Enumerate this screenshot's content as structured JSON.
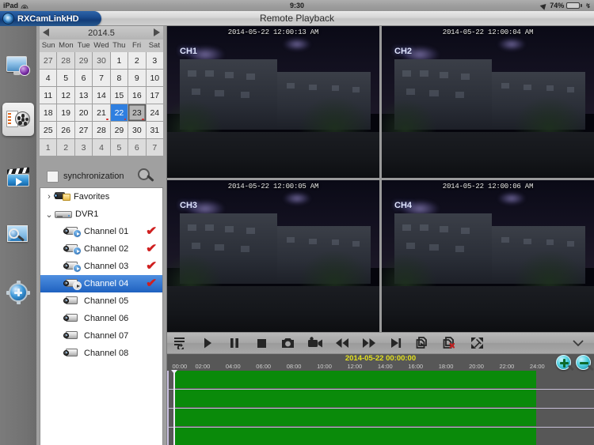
{
  "statusbar": {
    "device": "iPad",
    "time": "9:30",
    "battery": "74%",
    "wifi_icon": "wifi-icon",
    "location_icon": "location-arrow-icon",
    "battery_icon": "battery-icon"
  },
  "titlebar": {
    "app_name": "RXCamLinkHD",
    "title": "Remote Playback"
  },
  "rail": {
    "items": [
      {
        "name": "live-view",
        "icon": "monitor-camera-icon",
        "selected": false
      },
      {
        "name": "remote-playback",
        "icon": "film-reel-icon",
        "selected": true
      },
      {
        "name": "local-playback",
        "icon": "clapperboard-play-icon",
        "selected": false
      },
      {
        "name": "picture-viewer",
        "icon": "photo-magnifier-icon",
        "selected": false
      },
      {
        "name": "settings",
        "icon": "gear-icon",
        "selected": false
      }
    ]
  },
  "calendar": {
    "year_month": "2014.5",
    "prev_icon": "prev-arrow-icon",
    "next_icon": "next-arrow-icon",
    "dows": [
      "Sun",
      "Mon",
      "Tue",
      "Wed",
      "Thu",
      "Fri",
      "Sat"
    ],
    "weeks": [
      [
        {
          "d": "27",
          "dim": true
        },
        {
          "d": "28",
          "dim": true
        },
        {
          "d": "29",
          "dim": true
        },
        {
          "d": "30",
          "dim": true
        },
        {
          "d": "1"
        },
        {
          "d": "2"
        },
        {
          "d": "3"
        }
      ],
      [
        {
          "d": "4"
        },
        {
          "d": "5"
        },
        {
          "d": "6"
        },
        {
          "d": "7"
        },
        {
          "d": "8"
        },
        {
          "d": "9"
        },
        {
          "d": "10"
        }
      ],
      [
        {
          "d": "11"
        },
        {
          "d": "12"
        },
        {
          "d": "13"
        },
        {
          "d": "14"
        },
        {
          "d": "15"
        },
        {
          "d": "16"
        },
        {
          "d": "17"
        }
      ],
      [
        {
          "d": "18"
        },
        {
          "d": "19"
        },
        {
          "d": "20"
        },
        {
          "d": "21",
          "dot": true
        },
        {
          "d": "22",
          "sel": true,
          "dot": true
        },
        {
          "d": "23",
          "today": true,
          "dot": true
        },
        {
          "d": "24"
        }
      ],
      [
        {
          "d": "25"
        },
        {
          "d": "26"
        },
        {
          "d": "27"
        },
        {
          "d": "28"
        },
        {
          "d": "29"
        },
        {
          "d": "30"
        },
        {
          "d": "31"
        }
      ],
      [
        {
          "d": "1",
          "dim": true
        },
        {
          "d": "2",
          "dim": true
        },
        {
          "d": "3",
          "dim": true
        },
        {
          "d": "4",
          "dim": true
        },
        {
          "d": "5",
          "dim": true
        },
        {
          "d": "6",
          "dim": true
        },
        {
          "d": "7",
          "dim": true
        }
      ]
    ],
    "sync_label": "synchronization",
    "sync_checked": false,
    "search_icon": "magnifier-icon"
  },
  "tree": {
    "rows": [
      {
        "label": "Favorites",
        "kind": "group",
        "twist": "›",
        "icon": "camera-folder-icon",
        "checked": false,
        "selected": false
      },
      {
        "label": "DVR1",
        "kind": "device",
        "twist": "⌄",
        "icon": "dvr-box-icon",
        "checked": false,
        "selected": false
      },
      {
        "label": "Channel 01",
        "kind": "channel",
        "icon": "camera-play-icon",
        "playing": true,
        "checked": true,
        "selected": false
      },
      {
        "label": "Channel 02",
        "kind": "channel",
        "icon": "camera-play-icon",
        "playing": true,
        "checked": true,
        "selected": false
      },
      {
        "label": "Channel 03",
        "kind": "channel",
        "icon": "camera-play-icon",
        "playing": true,
        "checked": true,
        "selected": false
      },
      {
        "label": "Channel 04",
        "kind": "channel",
        "icon": "camera-play-icon",
        "playing": true,
        "checked": true,
        "selected": true
      },
      {
        "label": "Channel 05",
        "kind": "channel",
        "icon": "camera-icon",
        "playing": false,
        "checked": false,
        "selected": false
      },
      {
        "label": "Channel 06",
        "kind": "channel",
        "icon": "camera-icon",
        "playing": false,
        "checked": false,
        "selected": false
      },
      {
        "label": "Channel 07",
        "kind": "channel",
        "icon": "camera-icon",
        "playing": false,
        "checked": false,
        "selected": false
      },
      {
        "label": "Channel 08",
        "kind": "channel",
        "icon": "camera-icon",
        "playing": false,
        "checked": false,
        "selected": false
      }
    ],
    "check_glyph": "✔"
  },
  "video": {
    "panes": [
      {
        "channel": "CH1",
        "timestamp": "2014-05-22 12:00:13 AM"
      },
      {
        "channel": "CH2",
        "timestamp": "2014-05-22 12:00:04 AM"
      },
      {
        "channel": "CH3",
        "timestamp": "2014-05-22 12:00:05 AM"
      },
      {
        "channel": "CH4",
        "timestamp": "2014-05-22 12:00:06 AM"
      }
    ]
  },
  "toolbar": {
    "buttons": [
      {
        "name": "playlist-reload-button",
        "icon": "list-refresh-icon"
      },
      {
        "name": "play-button",
        "icon": "play-icon"
      },
      {
        "name": "pause-button",
        "icon": "pause-icon"
      },
      {
        "name": "stop-button",
        "icon": "stop-icon"
      },
      {
        "name": "snapshot-button",
        "icon": "camera-shutter-icon"
      },
      {
        "name": "record-button",
        "icon": "video-camera-icon"
      },
      {
        "name": "rewind-button",
        "icon": "rewind-icon"
      },
      {
        "name": "fast-forward-button",
        "icon": "fast-forward-icon"
      },
      {
        "name": "step-frame-button",
        "icon": "step-next-icon"
      },
      {
        "name": "clip-start-button",
        "icon": "clip-play-icon"
      },
      {
        "name": "clip-cancel-button",
        "icon": "clip-cancel-icon"
      },
      {
        "name": "fullscreen-button",
        "icon": "expand-arrows-icon"
      }
    ],
    "collapse_icon": "chevron-down-icon"
  },
  "timeline": {
    "date_label": "2014-05-22 00:00:00",
    "ticks": [
      "00:00",
      "02:00",
      "04:00",
      "06:00",
      "08:00",
      "10:00",
      "12:00",
      "14:00",
      "16:00",
      "18:00",
      "20:00",
      "22:00",
      "24:00"
    ],
    "zoom_in_icon": "zoom-in-magnifier-icon",
    "zoom_out_icon": "zoom-out-magnifier-icon",
    "tracks": [
      {
        "channel": "Channel 01",
        "start_pct": 1.5,
        "end_pct": 86.5
      },
      {
        "channel": "Channel 02",
        "start_pct": 1.5,
        "end_pct": 86.5
      },
      {
        "channel": "Channel 03",
        "start_pct": 1.5,
        "end_pct": 86.5
      },
      {
        "channel": "Channel 04",
        "start_pct": 1.5,
        "end_pct": 86.5
      }
    ],
    "playhead_pct": 1.5,
    "record_color": "#0a8a0a"
  }
}
